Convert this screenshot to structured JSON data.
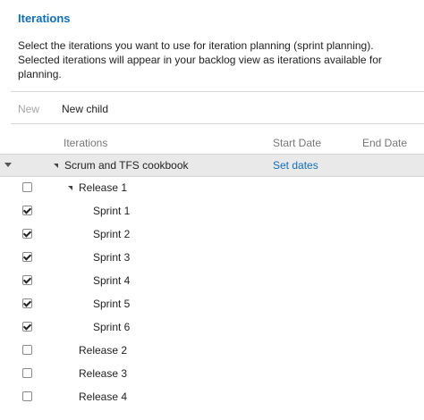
{
  "page": {
    "title": "Iterations",
    "description": "Select the iterations you want to use for iteration planning (sprint planning). Selected iterations will appear in your backlog view as iterations available for planning."
  },
  "toolbar": {
    "new_label": "New",
    "new_child_label": "New child"
  },
  "columns": {
    "iterations": "Iterations",
    "start_date": "Start Date",
    "end_date": "End Date"
  },
  "root": {
    "label": "Scrum and TFS cookbook",
    "set_dates_label": "Set dates"
  },
  "rows": [
    {
      "label": "Release 1",
      "checked": false
    },
    {
      "label": "Sprint 1",
      "checked": true
    },
    {
      "label": "Sprint 2",
      "checked": true
    },
    {
      "label": "Sprint 3",
      "checked": true
    },
    {
      "label": "Sprint 4",
      "checked": true
    },
    {
      "label": "Sprint 5",
      "checked": true
    },
    {
      "label": "Sprint 6",
      "checked": true
    },
    {
      "label": "Release 2",
      "checked": false
    },
    {
      "label": "Release 3",
      "checked": false
    },
    {
      "label": "Release 4",
      "checked": false
    }
  ]
}
